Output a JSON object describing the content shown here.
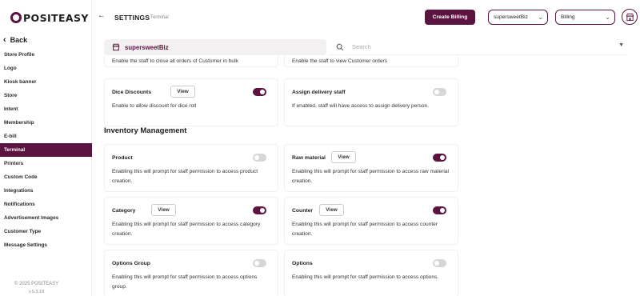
{
  "brand": {
    "logo_text": "POSITEASY",
    "accent": "#5b1440"
  },
  "sidebar": {
    "back_label": "Back",
    "items": [
      {
        "label": "Store Profile",
        "active": false
      },
      {
        "label": "Logo",
        "active": false
      },
      {
        "label": "Kiosk banner",
        "active": false
      },
      {
        "label": "Store",
        "active": false
      },
      {
        "label": "Intent",
        "active": false
      },
      {
        "label": "Membership",
        "active": false
      },
      {
        "label": "E-bill",
        "active": false
      },
      {
        "label": "Terminal",
        "active": true
      },
      {
        "label": "Printers",
        "active": false
      },
      {
        "label": "Custom Code",
        "active": false
      },
      {
        "label": "Integrations",
        "active": false
      },
      {
        "label": "Notifications",
        "active": false
      },
      {
        "label": "Advertisement Images",
        "active": false
      },
      {
        "label": "Customer Type",
        "active": false
      },
      {
        "label": "Message Settings",
        "active": false
      }
    ],
    "copyright": "© 2025 POSITEASY",
    "version": "v.5.3.18"
  },
  "header": {
    "title": "SETTINGS",
    "subtitle": "Terminal",
    "create_billing_label": "Create Billing",
    "store_select_value": "supersweetBiz",
    "mode_select_value": "Billing"
  },
  "store_bar": {
    "name": "supersweetBiz"
  },
  "search": {
    "placeholder": "Search"
  },
  "cut_text": {
    "left": "Enable the staff to close all orders of Customer in bulk",
    "right": "Enable the staff to view Customer orders"
  },
  "view_label": "View",
  "cards_top": [
    {
      "title": "Dice Discounts",
      "desc": "Enable to allow discount for dice roll",
      "has_view": true,
      "enabled": true
    },
    {
      "title": "Assign delivery staff",
      "desc": "If enabled, staff will have access to assign delivery person.",
      "has_view": false,
      "enabled": false
    }
  ],
  "inventory": {
    "section_title": "Inventory Management",
    "cards": [
      {
        "title": "Product",
        "desc": "Enabling this will prompt for staff permission to access product creation.",
        "has_view": false,
        "enabled": false
      },
      {
        "title": "Raw material",
        "desc": "Enabling this will prompt for staff permission to access raw material creation.",
        "has_view": true,
        "enabled": true
      },
      {
        "title": "Category",
        "desc": "Enabling this will prompt for staff permission to access category creation.",
        "has_view": true,
        "enabled": true
      },
      {
        "title": "Counter",
        "desc": "Enabling this will prompt for staff permission to access counter creation.",
        "has_view": true,
        "enabled": true
      },
      {
        "title": "Options Group",
        "desc": "Enabling this will prompt for staff permission to access options group.",
        "has_view": false,
        "enabled": false
      },
      {
        "title": "Options",
        "desc": "Enabling this will prompt for staff permission to access options.",
        "has_view": false,
        "enabled": false
      }
    ]
  },
  "icons": {
    "back": "chevron-left-icon",
    "store": "store-icon",
    "search": "search-icon",
    "avatar": "storefront-icon"
  }
}
